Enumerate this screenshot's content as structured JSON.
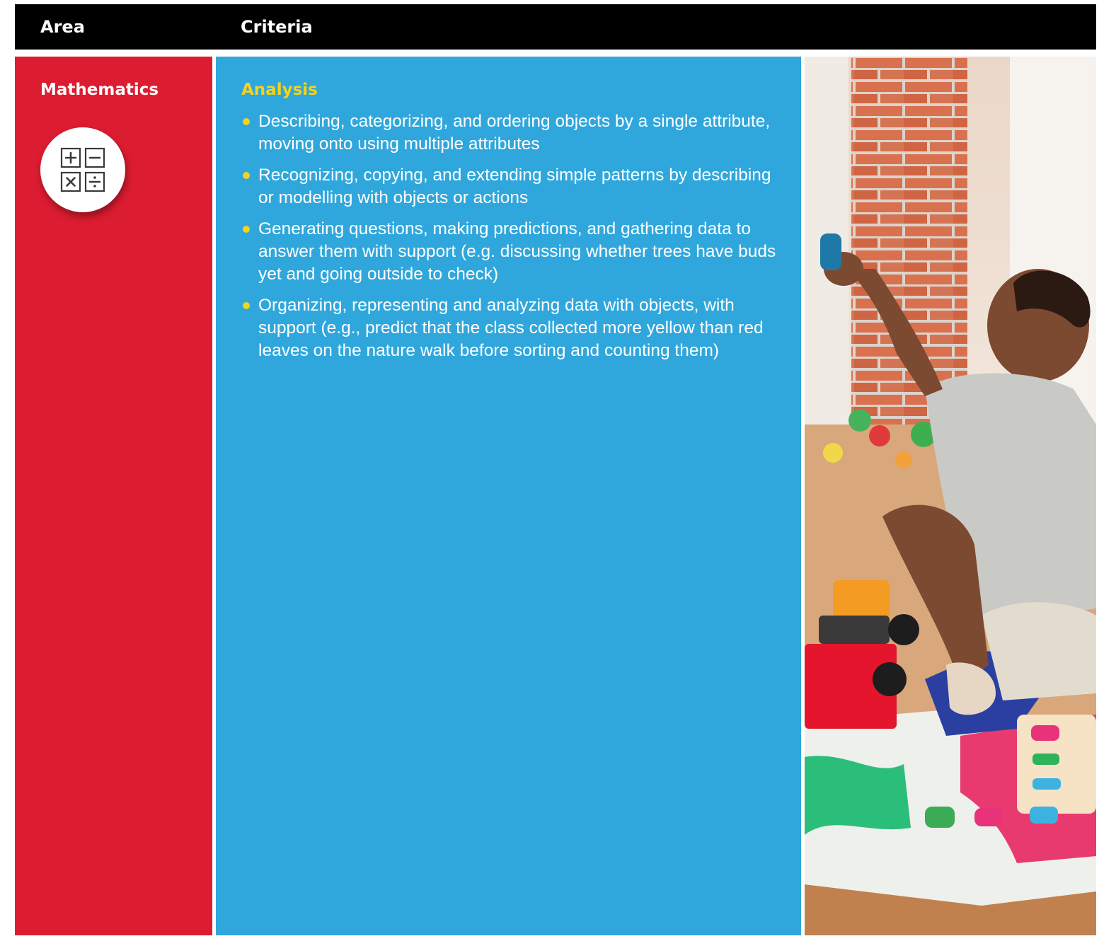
{
  "header": {
    "area_label": "Area",
    "criteria_label": "Criteria"
  },
  "area": {
    "title": "Mathematics",
    "icon": "calculator-operations-icon"
  },
  "criteria": {
    "title": "Analysis",
    "items": [
      "Describing, categorizing, and ordering objects by a single attribute, moving onto using multiple attributes",
      "Recognizing, copying, and extending simple patterns by describing or modelling with objects or actions",
      "Generating questions, making predictions, and gathering data to answer them with support (e.g. discussing whether trees have buds yet and going outside to check)",
      "Organizing, representing and analyzing data with objects, with support (e.g., predict that the class collected more yellow than red leaves on the nature walk before sorting and counting them)"
    ]
  },
  "colors": {
    "header_bg": "#000000",
    "area_bg": "#DC1C30",
    "criteria_bg": "#2FA7DC",
    "accent_yellow": "#F6D21B"
  }
}
